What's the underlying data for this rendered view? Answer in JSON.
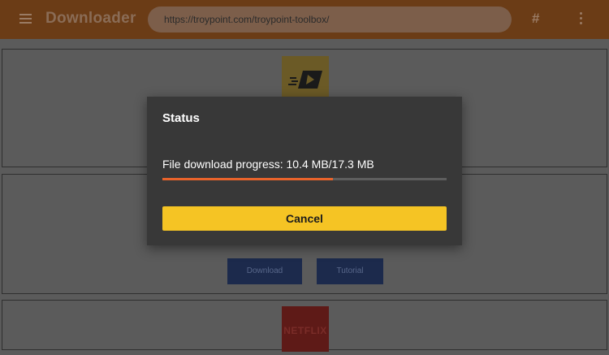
{
  "topbar": {
    "app_title": "Downloader",
    "url": "https://troypoint.com/troypoint-toolbox/",
    "hash_symbol": "#",
    "bar_color": "#6b3c16"
  },
  "cards": {
    "download_label": "Download",
    "tutorial_label": "Tutorial",
    "netflix_label": "NETFLIX"
  },
  "dialog": {
    "title": "Status",
    "progress_text": "File download progress: 10.4 MB/17.3 MB",
    "progress_fraction": 0.6,
    "progress_color": "#e8632b",
    "cancel_label": "Cancel",
    "cancel_color": "#f5c424"
  }
}
